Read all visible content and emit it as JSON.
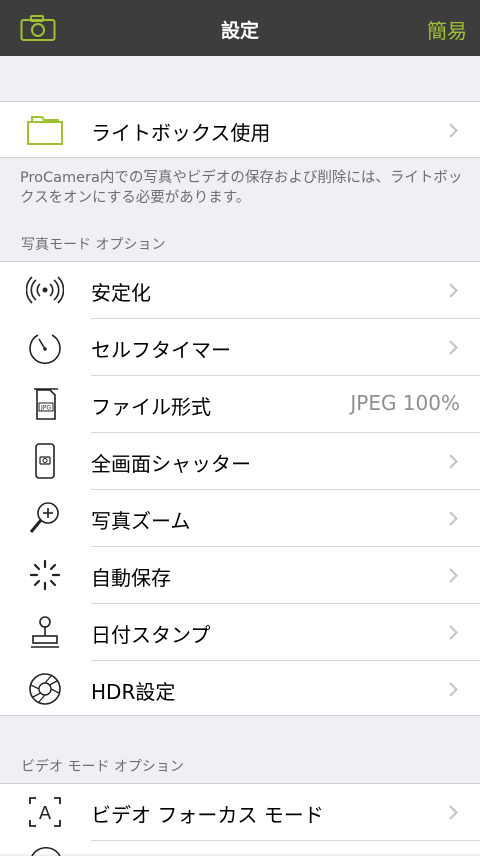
{
  "nav": {
    "title": "設定",
    "right": "簡易"
  },
  "lightbox": {
    "label": "ライトボックス使用"
  },
  "footnote": "ProCamera内での写真やビデオの保存および削除には、ライトボックスをオンにする必要があります。",
  "photo_section": {
    "header": "写真モード オプション",
    "items": [
      {
        "label": "安定化",
        "icon": "stabilizer-icon"
      },
      {
        "label": "セルフタイマー",
        "icon": "timer-icon"
      },
      {
        "label": "ファイル形式",
        "value": "JPEG 100%",
        "icon": "jpg-file-icon"
      },
      {
        "label": "全画面シャッター",
        "icon": "fullscreen-shutter-icon"
      },
      {
        "label": "写真ズーム",
        "icon": "zoom-icon"
      },
      {
        "label": "自動保存",
        "icon": "autosave-icon"
      },
      {
        "label": "日付スタンプ",
        "icon": "stamp-icon"
      },
      {
        "label": "HDR設定",
        "icon": "aperture-icon"
      }
    ]
  },
  "video_section": {
    "header": "ビデオ モード オプション",
    "items": [
      {
        "label": "ビデオ フォーカス モード",
        "icon": "focus-a-icon"
      }
    ]
  },
  "colors": {
    "accent": "#9ec234",
    "navbar": "#3d3d3d"
  }
}
